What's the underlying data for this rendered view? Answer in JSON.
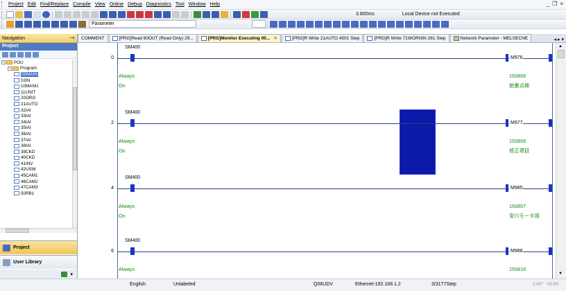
{
  "menubar": {
    "items": [
      "Project",
      "Edit",
      "Find/Replace",
      "Compile",
      "View",
      "Online",
      "Debug",
      "Diagnostics",
      "Tool",
      "Window",
      "Help"
    ],
    "window_controls": [
      "_",
      "—",
      "×"
    ]
  },
  "toolbar1": {
    "scan_time": "3.800ms",
    "device_status": "Local Device not Executed"
  },
  "toolbar2": {
    "parameter_field": "Parameter"
  },
  "navigation": {
    "title": "Navigation",
    "pin_close": "−×",
    "project_header": "Project",
    "tree": [
      {
        "label": "POU",
        "level": 0,
        "type": "folder",
        "expanded": true
      },
      {
        "label": "Program",
        "level": 1,
        "type": "folder",
        "expanded": true
      },
      {
        "label": "00MAIN",
        "level": 2,
        "type": "prog",
        "selected": true
      },
      {
        "label": "02IN",
        "level": 2,
        "type": "prog"
      },
      {
        "label": "10MANU",
        "level": 2,
        "type": "prog"
      },
      {
        "label": "11UNIT",
        "level": 2,
        "type": "prog"
      },
      {
        "label": "20ORG",
        "level": 2,
        "type": "prog"
      },
      {
        "label": "21AUTO",
        "level": 2,
        "type": "prog"
      },
      {
        "label": "32IAI",
        "level": 2,
        "type": "prog"
      },
      {
        "label": "33IAI",
        "level": 2,
        "type": "prog"
      },
      {
        "label": "34IAI",
        "level": 2,
        "type": "prog"
      },
      {
        "label": "35IAI",
        "level": 2,
        "type": "prog"
      },
      {
        "label": "36IAI",
        "level": 2,
        "type": "prog"
      },
      {
        "label": "37IAI",
        "level": 2,
        "type": "prog"
      },
      {
        "label": "38IAI",
        "level": 2,
        "type": "prog"
      },
      {
        "label": "39CKD",
        "level": 2,
        "type": "prog"
      },
      {
        "label": "40CKD",
        "level": 2,
        "type": "prog"
      },
      {
        "label": "41INV",
        "level": 2,
        "type": "prog"
      },
      {
        "label": "42USW",
        "level": 2,
        "type": "prog"
      },
      {
        "label": "45CAM1",
        "level": 2,
        "type": "prog"
      },
      {
        "label": "46CAM2",
        "level": 2,
        "type": "prog"
      },
      {
        "label": "47CAM3",
        "level": 2,
        "type": "prog"
      },
      {
        "label": "50RB1",
        "level": 2,
        "type": "prog"
      }
    ],
    "bottom_buttons": {
      "project": "Project",
      "user_library": "User Library"
    }
  },
  "tabs": [
    {
      "label": "COMMENT",
      "active": false,
      "icon": false
    },
    {
      "label": "[PRG]Read 90OUT (Read Only) 29...",
      "active": false,
      "icon": true
    },
    {
      "label": "[PRG]Monitor Executing 00...",
      "active": true,
      "icon": true,
      "closable": true
    },
    {
      "label": "[PRG]R Write 21AUTO 4501 Step",
      "active": false,
      "icon": true
    },
    {
      "label": "[PRG]R Write 71WORNIN 261 Step",
      "active": false,
      "icon": true
    },
    {
      "label": "Network Parameter - MELSECNE",
      "active": false,
      "icon": true
    }
  ],
  "tab_arrows": "◂ ▸ ▾",
  "ladder": {
    "rungs": [
      {
        "step": "0",
        "contact": "SM400",
        "coil": "M976",
        "comment_left_1": "Always",
        "comment_left_2": "On",
        "comment_right_1": "150806",
        "comment_right_2": "始業点検"
      },
      {
        "step": "2",
        "contact": "SM400",
        "coil": "M977",
        "comment_left_1": "Always",
        "comment_left_2": "On",
        "comment_right_1": "150806",
        "comment_right_2": "修正項目"
      },
      {
        "step": "4",
        "contact": "SM400",
        "coil": "M985",
        "comment_left_1": "Always",
        "comment_left_2": "On",
        "comment_right_1": "150807",
        "comment_right_2": "安川モータ用"
      },
      {
        "step": "6",
        "contact": "SM400",
        "coil": "M988",
        "comment_left_1": "Always",
        "comment_left_2": "",
        "comment_right_1": "150816",
        "comment_right_2": ""
      }
    ]
  },
  "statusbar": {
    "language": "English",
    "label_mode": "Unlabeled",
    "cpu": "Q06UDV",
    "connection": "Ethernet-192.168.1.2",
    "steps": "3/3177Step",
    "cap": "CAP",
    "num": "NUM"
  },
  "colors": {
    "contact": "#1a33c7",
    "comment": "#0f8b0f",
    "selection": "#0b1aa8",
    "nav_header": "#f4cf6a",
    "active_tab": "#fdf2c7"
  }
}
